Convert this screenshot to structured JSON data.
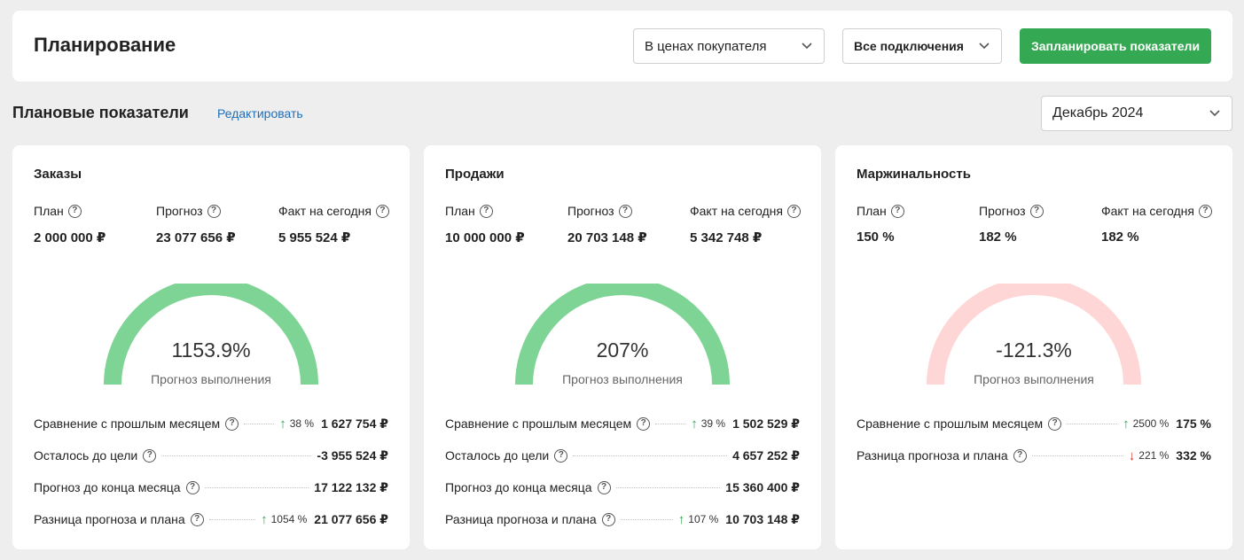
{
  "header": {
    "title": "Планирование",
    "price_select": "В ценах покупателя",
    "connections_select": "Все подключения",
    "plan_button": "Запланировать показатели"
  },
  "section": {
    "title": "Плановые показатели",
    "edit_link": "Редактировать",
    "month_select": "Декабрь 2024"
  },
  "colors": {
    "accent_green": "#35a853",
    "gauge_green": "#7dd494",
    "gauge_pink": "#ffd6d6",
    "link_blue": "#1f6fb8",
    "arrow_red": "#d9342b"
  },
  "cards": [
    {
      "title": "Заказы",
      "metrics": [
        {
          "label": "План",
          "value": "2 000 000 ₽"
        },
        {
          "label": "Прогноз",
          "value": "23 077 656 ₽"
        },
        {
          "label": "Факт на сегодня",
          "value": "5 955 524 ₽"
        }
      ],
      "gauge": {
        "value": "1153.9%",
        "caption": "Прогноз выполнения",
        "color": "#7dd494"
      },
      "rows": [
        {
          "label": "Сравнение с прошлым месяцем",
          "change": "38 %",
          "direction": "up",
          "value": "1 627 754 ₽"
        },
        {
          "label": "Осталось до цели",
          "change": "",
          "direction": "",
          "value": "-3 955 524 ₽"
        },
        {
          "label": "Прогноз до конца месяца",
          "change": "",
          "direction": "",
          "value": "17 122 132 ₽"
        },
        {
          "label": "Разница прогноза и плана",
          "change": "1054 %",
          "direction": "up",
          "value": "21 077 656 ₽"
        }
      ]
    },
    {
      "title": "Продажи",
      "metrics": [
        {
          "label": "План",
          "value": "10 000 000 ₽"
        },
        {
          "label": "Прогноз",
          "value": "20 703 148 ₽"
        },
        {
          "label": "Факт на сегодня",
          "value": "5 342 748 ₽"
        }
      ],
      "gauge": {
        "value": "207%",
        "caption": "Прогноз выполнения",
        "color": "#7dd494"
      },
      "rows": [
        {
          "label": "Сравнение с прошлым месяцем",
          "change": "39 %",
          "direction": "up",
          "value": "1 502 529 ₽"
        },
        {
          "label": "Осталось до цели",
          "change": "",
          "direction": "",
          "value": "4 657 252 ₽"
        },
        {
          "label": "Прогноз до конца месяца",
          "change": "",
          "direction": "",
          "value": "15 360 400 ₽"
        },
        {
          "label": "Разница прогноза и плана",
          "change": "107 %",
          "direction": "up",
          "value": "10 703 148 ₽"
        }
      ]
    },
    {
      "title": "Маржинальность",
      "metrics": [
        {
          "label": "План",
          "value": "150 %"
        },
        {
          "label": "Прогноз",
          "value": "182 %"
        },
        {
          "label": "Факт на сегодня",
          "value": "182 %"
        }
      ],
      "gauge": {
        "value": "-121.3%",
        "caption": "Прогноз выполнения",
        "color": "#ffd6d6"
      },
      "rows": [
        {
          "label": "Сравнение с прошлым месяцем",
          "change": "2500 %",
          "direction": "up",
          "value": "175 %"
        },
        {
          "label": "Разница прогноза и плана",
          "change": "221 %",
          "direction": "down",
          "value": "332 %"
        }
      ]
    }
  ]
}
